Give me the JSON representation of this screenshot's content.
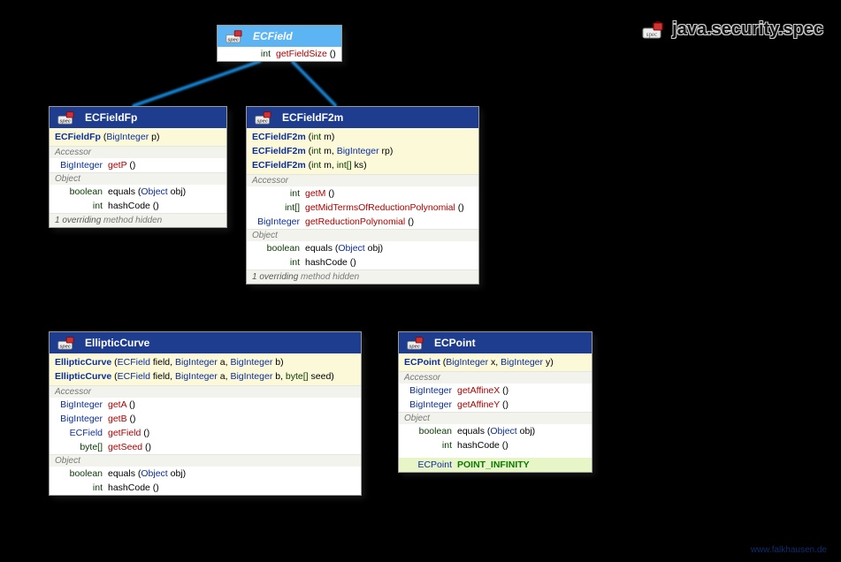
{
  "package": {
    "name": "java.security.spec",
    "icon": "spec"
  },
  "footer": "www.falkhausen.de",
  "ecfield": {
    "title": "ECField",
    "rows": [
      {
        "ret": "int",
        "retKind": "prim",
        "name": "getFieldSize",
        "nameKind": "fn",
        "sig": " ()"
      }
    ]
  },
  "ecfieldfp": {
    "title": "ECFieldFp",
    "ctors": [
      {
        "name": "ECFieldFp",
        "params": [
          {
            "t": "BigInteger",
            "k": "typ"
          },
          {
            "a": " p"
          }
        ]
      }
    ],
    "sections": [
      {
        "label": "Accessor",
        "rows": [
          {
            "ret": "BigInteger",
            "retKind": "bi",
            "name": "getP",
            "nameKind": "fn",
            "sig": " ()"
          }
        ]
      },
      {
        "label": "Object",
        "rows": [
          {
            "ret": "boolean",
            "retKind": "prim",
            "name": "equals",
            "nameKind": "fn-black",
            "sig": " (",
            "params": [
              {
                "t": "Object",
                "k": "typ"
              },
              {
                "a": " obj)"
              }
            ]
          },
          {
            "ret": "int",
            "retKind": "prim",
            "name": "hashCode",
            "nameKind": "fn-black",
            "sig": " ()"
          }
        ]
      }
    ],
    "note_pre": "1 overriding",
    "note_post": " method hidden"
  },
  "ecfieldf2m": {
    "title": "ECFieldF2m",
    "ctors": [
      {
        "name": "ECFieldF2m",
        "params": [
          {
            "t": "int",
            "k": "prim"
          },
          {
            "a": " m"
          }
        ]
      },
      {
        "name": "ECFieldF2m",
        "params": [
          {
            "t": "int",
            "k": "prim"
          },
          {
            "a": " m, "
          },
          {
            "t": "BigInteger",
            "k": "typ"
          },
          {
            "a": " rp"
          }
        ]
      },
      {
        "name": "ECFieldF2m",
        "params": [
          {
            "t": "int",
            "k": "prim"
          },
          {
            "a": " m, "
          },
          {
            "t": "int[]",
            "k": "prim"
          },
          {
            "a": " ks"
          }
        ]
      }
    ],
    "sections": [
      {
        "label": "Accessor",
        "rows": [
          {
            "ret": "int",
            "retKind": "prim",
            "name": "getM",
            "nameKind": "fn",
            "sig": " ()"
          },
          {
            "ret": "int[]",
            "retKind": "prim",
            "name": "getMidTermsOfReductionPolynomial",
            "nameKind": "fn",
            "sig": " ()"
          },
          {
            "ret": "BigInteger",
            "retKind": "bi",
            "name": "getReductionPolynomial",
            "nameKind": "fn",
            "sig": " ()"
          }
        ]
      },
      {
        "label": "Object",
        "rows": [
          {
            "ret": "boolean",
            "retKind": "prim",
            "name": "equals",
            "nameKind": "fn-black",
            "sig": " (",
            "params": [
              {
                "t": "Object",
                "k": "typ"
              },
              {
                "a": " obj)"
              }
            ]
          },
          {
            "ret": "int",
            "retKind": "prim",
            "name": "hashCode",
            "nameKind": "fn-black",
            "sig": " ()"
          }
        ]
      }
    ],
    "note_pre": "1 overriding",
    "note_post": " method hidden"
  },
  "ellipticcurve": {
    "title": "EllipticCurve",
    "ctors": [
      {
        "name": "EllipticCurve",
        "params": [
          {
            "t": "ECField",
            "k": "typ"
          },
          {
            "a": " field, "
          },
          {
            "t": "BigInteger",
            "k": "typ"
          },
          {
            "a": " a, "
          },
          {
            "t": "BigInteger",
            "k": "typ"
          },
          {
            "a": " b"
          }
        ]
      },
      {
        "name": "EllipticCurve",
        "params": [
          {
            "t": "ECField",
            "k": "typ"
          },
          {
            "a": " field, "
          },
          {
            "t": "BigInteger",
            "k": "typ"
          },
          {
            "a": " a, "
          },
          {
            "t": "BigInteger",
            "k": "typ"
          },
          {
            "a": " b, "
          },
          {
            "t": "byte[]",
            "k": "prim"
          },
          {
            "a": " seed"
          }
        ]
      }
    ],
    "sections": [
      {
        "label": "Accessor",
        "rows": [
          {
            "ret": "BigInteger",
            "retKind": "bi",
            "name": "getA",
            "nameKind": "fn",
            "sig": " ()"
          },
          {
            "ret": "BigInteger",
            "retKind": "bi",
            "name": "getB",
            "nameKind": "fn",
            "sig": " ()"
          },
          {
            "ret": "ECField",
            "retKind": "bi",
            "name": "getField",
            "nameKind": "fn",
            "sig": " ()"
          },
          {
            "ret": "byte[]",
            "retKind": "prim",
            "name": "getSeed",
            "nameKind": "fn",
            "sig": " ()"
          }
        ]
      },
      {
        "label": "Object",
        "rows": [
          {
            "ret": "boolean",
            "retKind": "prim",
            "name": "equals",
            "nameKind": "fn-black",
            "sig": " (",
            "params": [
              {
                "t": "Object",
                "k": "typ"
              },
              {
                "a": " obj)"
              }
            ]
          },
          {
            "ret": "int",
            "retKind": "prim",
            "name": "hashCode",
            "nameKind": "fn-black",
            "sig": " ()"
          }
        ]
      }
    ]
  },
  "ecpoint": {
    "title": "ECPoint",
    "ctors": [
      {
        "name": "ECPoint",
        "params": [
          {
            "t": "BigInteger",
            "k": "typ"
          },
          {
            "a": " x, "
          },
          {
            "t": "BigInteger",
            "k": "typ"
          },
          {
            "a": " y"
          }
        ]
      }
    ],
    "sections": [
      {
        "label": "Accessor",
        "rows": [
          {
            "ret": "BigInteger",
            "retKind": "bi",
            "name": "getAffineX",
            "nameKind": "fn",
            "sig": " ()"
          },
          {
            "ret": "BigInteger",
            "retKind": "bi",
            "name": "getAffineY",
            "nameKind": "fn",
            "sig": " ()"
          }
        ]
      },
      {
        "label": "Object",
        "rows": [
          {
            "ret": "boolean",
            "retKind": "prim",
            "name": "equals",
            "nameKind": "fn-black",
            "sig": " (",
            "params": [
              {
                "t": "Object",
                "k": "typ"
              },
              {
                "a": " obj)"
              }
            ]
          },
          {
            "ret": "int",
            "retKind": "prim",
            "name": "hashCode",
            "nameKind": "fn-black",
            "sig": " ()"
          }
        ]
      }
    ],
    "constant": {
      "ret": "ECPoint",
      "name": "POINT_INFINITY"
    }
  }
}
